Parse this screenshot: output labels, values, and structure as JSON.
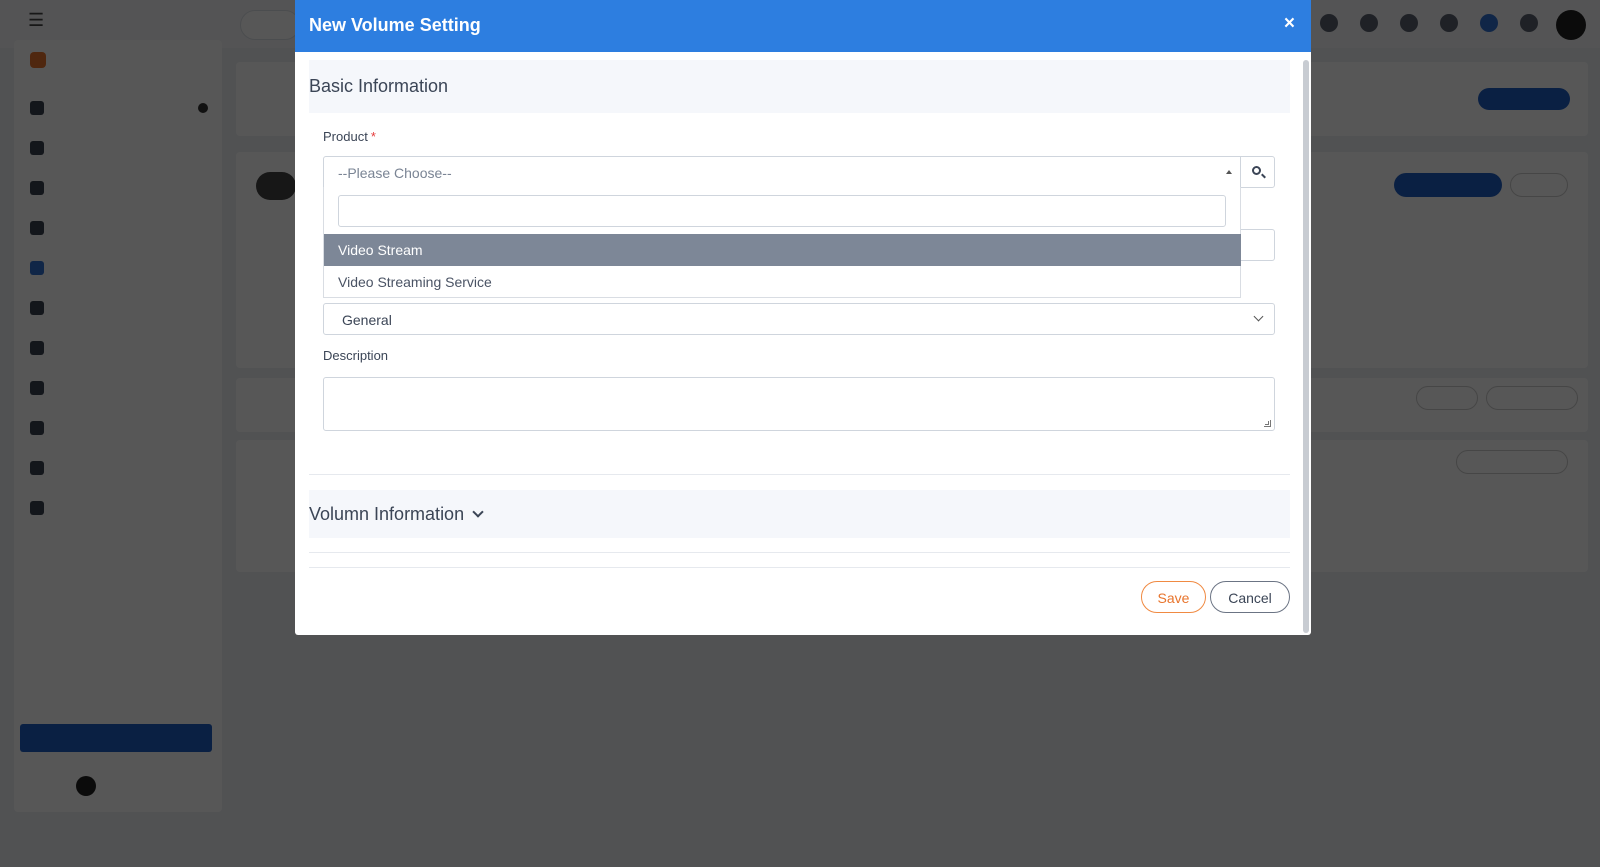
{
  "modal": {
    "title": "New Volume Setting",
    "close_icon": "×",
    "basic_section_title": "Basic Information",
    "product_label": "Product",
    "required_marker": "*",
    "product_placeholder": "--Please Choose--",
    "dropdown_search_value": "",
    "options": [
      "Video Stream",
      "Video Streaming Service"
    ],
    "highlighted_option": "Video Stream",
    "type_value": "General",
    "description_label": "Description",
    "description_value": "",
    "volumn_section_title": "Volumn Information",
    "save_label": "Save",
    "cancel_label": "Cancel"
  },
  "colors": {
    "header": "#2d7ee0",
    "save_accent": "#e8742c",
    "highlight": "#7d8797",
    "required": "#e63b3b"
  }
}
